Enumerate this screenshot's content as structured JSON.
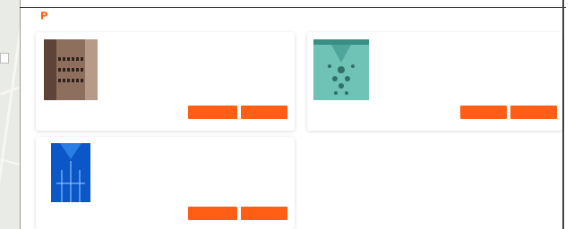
{
  "header": {
    "logo_text": "",
    "top_link": ""
  },
  "map": {
    "labels": []
  },
  "products": [
    {
      "title": "",
      "description": "",
      "meta": "",
      "owner": "",
      "primary_btn": "",
      "secondary_btn": ""
    },
    {
      "title": "",
      "description": "",
      "meta": "",
      "owner": "",
      "primary_btn": "",
      "secondary_btn": ""
    },
    {
      "title": "",
      "description": "",
      "meta": "",
      "owner": "",
      "primary_btn": "",
      "secondary_btn": ""
    }
  ],
  "colors": {
    "accent": "#ff5e14",
    "link": "#ff6a2a"
  }
}
